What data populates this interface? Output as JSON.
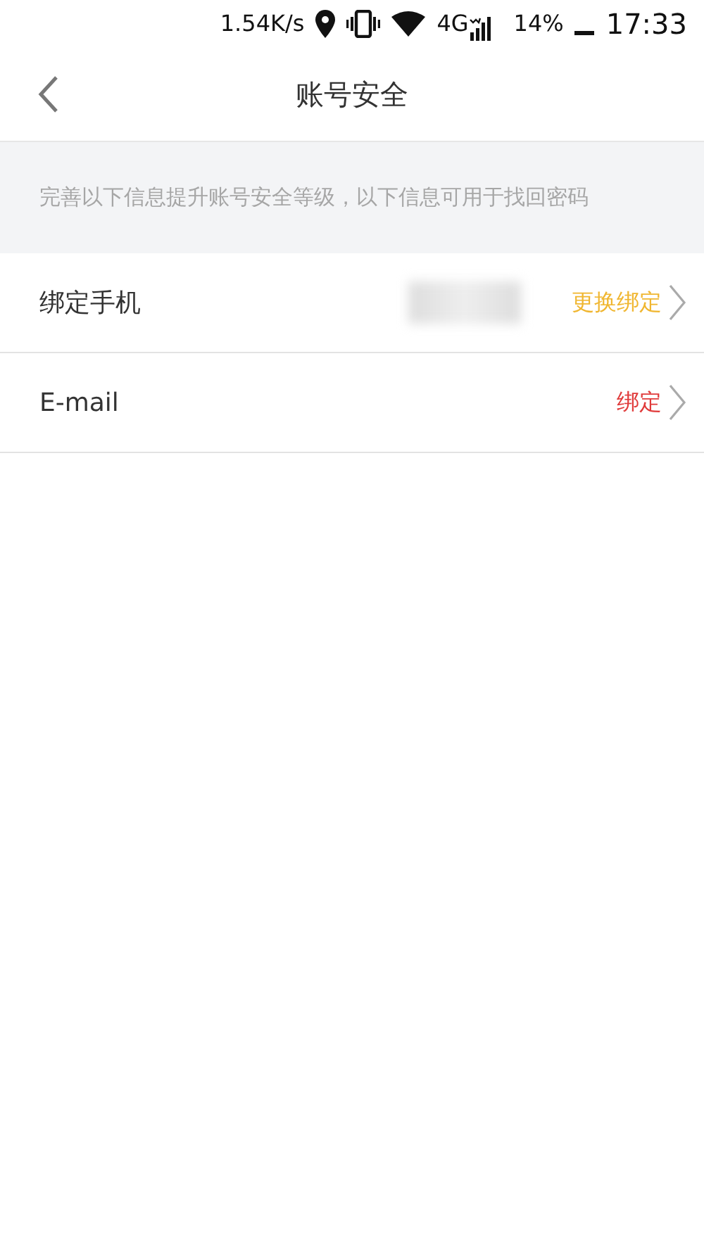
{
  "status_bar": {
    "speed": "1.54K/s",
    "network": "4G",
    "battery": "14%",
    "time": "17:33"
  },
  "header": {
    "title": "账号安全"
  },
  "notice": "完善以下信息提升账号安全等级，以下信息可用于找回密码",
  "rows": [
    {
      "label": "绑定手机",
      "redacted": true,
      "action": "更换绑定",
      "color": "#f0b630"
    },
    {
      "label": "E-mail",
      "redacted": false,
      "action": "绑定",
      "color": "#e03a3a"
    }
  ]
}
